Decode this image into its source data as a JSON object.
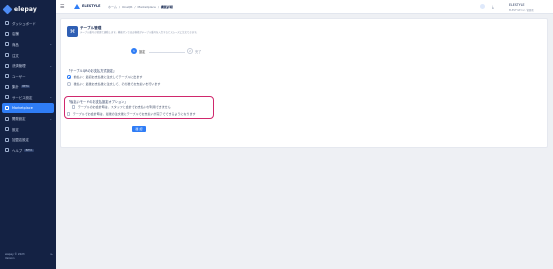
{
  "app": {
    "logo": "elepay"
  },
  "sidebar": {
    "items": [
      {
        "label": "ダッシュボード",
        "chevron": false,
        "badge": ""
      },
      {
        "label": "店舗",
        "chevron": false,
        "badge": ""
      },
      {
        "label": "商品",
        "chevron": true,
        "badge": ""
      },
      {
        "label": "注文",
        "chevron": false,
        "badge": ""
      },
      {
        "label": "決済管理",
        "chevron": true,
        "badge": ""
      },
      {
        "label": "ユーザー",
        "chevron": false,
        "badge": ""
      },
      {
        "label": "集計",
        "chevron": false,
        "badge": "BETA"
      },
      {
        "label": "サービス設定",
        "chevron": true,
        "badge": ""
      },
      {
        "label": "Marketplace",
        "chevron": false,
        "badge": "",
        "active": true
      },
      {
        "label": "開発設定",
        "chevron": true,
        "badge": ""
      },
      {
        "label": "設定",
        "chevron": false,
        "badge": ""
      },
      {
        "label": "加盟店設定",
        "chevron": false,
        "badge": ""
      },
      {
        "label": "ヘルプ",
        "chevron": false,
        "badge": "BETA"
      }
    ],
    "footer_line1": "elepay © 2023",
    "footer_line2": "Version"
  },
  "header": {
    "brand": "ELESTYLE",
    "breadcrumbs": [
      "ホーム",
      "OneQR",
      "Marketplace",
      "機能詳細"
    ],
    "user_name": "ELESTYLE",
    "user_sub": "ELESTYLE Inc. 管理者"
  },
  "card": {
    "title": "テーブル管理",
    "description": "テーブル番号の管理と連動します。機能オンではお客様がテーブル番号を入力するとスムーズに注文できます。",
    "steps": [
      {
        "num": "1",
        "label": "設定"
      },
      {
        "num": "2",
        "label": "完了"
      }
    ],
    "section1_title": "「テーブルQRのお支払方式設定」",
    "radio1": "前払い：最初お支払後に注文してテーブルに出ます",
    "radio2": "後払い：最後お支払後に注文して、その後でお支払いを行います",
    "section2_title": "「後払いモードのお支払設定オプション」",
    "option1": "テーブルのお会計時は、スタッフと会計でお支払いが利用できません",
    "option2": "テーブルでお会計時は、最後の注文後にテーブルでお支払いが完了でできるようになります",
    "confirm": "確 認"
  },
  "colors": {
    "accent": "#2f7df6",
    "sidebar": "#142244",
    "highlight": "#d0286d"
  }
}
